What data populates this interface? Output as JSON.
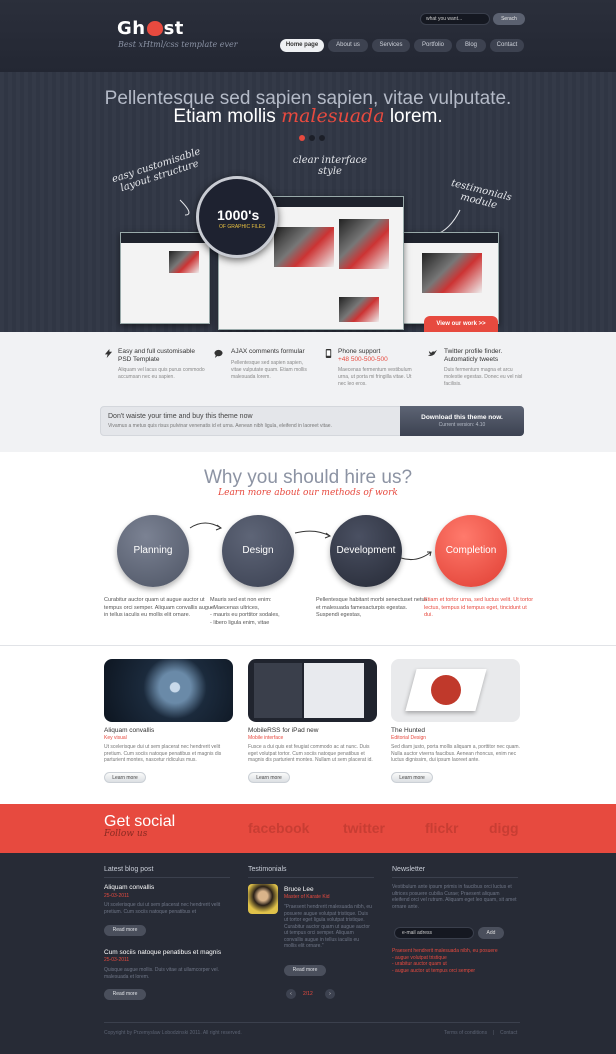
{
  "header": {
    "logo_pre": "Gh",
    "logo_post": "st",
    "tagline": "Best xHtml/css template ever",
    "search_placeholder": "what you want...",
    "search_button": "Serach",
    "nav": [
      "Home page",
      "About us",
      "Services",
      "Portfolio",
      "Blog",
      "Contact"
    ]
  },
  "hero": {
    "line1": "Pellentesque sed sapien sapien, vitae vulputate.",
    "line2_pre": "Etiam mollis",
    "line2_highlight": "malesuada",
    "line2_post": "lorem.",
    "note_left": "easy customisable layout structure",
    "note_center": "clear interface style",
    "note_right": "testimonials module",
    "magnifier_big": "1000's",
    "magnifier_small": "OF GRAPHIC FILES",
    "view_work": "View our work >>"
  },
  "features": [
    {
      "title": "Easy and full customisable PSD Template",
      "text": "Aliquam vel lacus quis purus commodo accumsan nec eu sapien."
    },
    {
      "title": "AJAX comments formular",
      "text": "Pellentesque sed sapien sapien, vitae vulputate quam. Etiam mollis malesuada lorem."
    },
    {
      "title": "Phone support",
      "phone": "+48 500-500-500",
      "text": "Maecenas fermentum vestibulum urna, ut porta mi fringilla vitae. Ut nec leo eros."
    },
    {
      "title": "Twitter profile finder. Automaticly tweets",
      "text": "Duis fermentum magna et arcu molestie egestas. Donec eu vel nisl facilisis."
    }
  ],
  "buybar": {
    "title": "Don't waiste your time and buy this theme now",
    "text": "Vivamus a metus quis risus pulvinar venenatis id et urna. Aenean nibh ligula, eleifend in laoreet vitae.",
    "button": "Download this theme now.",
    "version": "Current version: 4.10"
  },
  "why": {
    "title": "Why you should hire us?",
    "subtitle": "Learn more about our methods of work",
    "steps": [
      {
        "label": "Planning",
        "text": "Curabitur auctor quam ut augue auctor ut tempus orci semper. Aliquam convallis augue in tellus iaculis eu mollis elit ornare."
      },
      {
        "label": "Design",
        "text": "Mauris sed est non enim:",
        "list": [
          "- Maecenas ultrices,",
          "- mauris eu porttitor sodales,",
          "- libero ligula enim, vitae"
        ]
      },
      {
        "label": "Development",
        "text": "Pellentesque habitant morbi senectuset netus et malesuada famesacturpis egestas. Suspendi egestas,"
      },
      {
        "label": "Completion",
        "text": "Etiam et tortor urna, sed luctus velit. Ut tortor lectus, tempus id tempus eget, tincidunt ut dui."
      }
    ]
  },
  "portfolio": [
    {
      "title": "Aliquam convallis",
      "category": "Key visual",
      "text": "Ut scelerisque dui ut sem placerat nec hendrerit velit pretium. Cum sociis natoque penatibus et magnis dis parturient montes, nascetur ridiculus mus.",
      "button": "Learn more"
    },
    {
      "title": "MobileRSS for iPad new",
      "category": "Mobile interface",
      "text": "Fusce a dui quis est feugiat commodo ac at nunc. Duis eget volutpat tortor. Cum sociis natoque penatibus et magnis dis parturient montes. Nullam ut sem placerat id.",
      "button": "Learn more"
    },
    {
      "title": "The Hunted",
      "category": "Editorial Design",
      "text": "Sed diam justo, porta mollis aliquam a, porttitor nec quam. Nulla auctor viverra faucibus. Aenean rhoncus, enim nec luctus dignissim, dui ipsum laoreet ante.",
      "button": "Learn more"
    }
  ],
  "social": {
    "title": "Get social",
    "subtitle": "Follow us",
    "networks": [
      "facebook",
      "twitter",
      "flickr",
      "digg"
    ]
  },
  "footer": {
    "blog_heading": "Latest blog post",
    "posts": [
      {
        "title": "Aliquam convallis",
        "date": "25-03-2011",
        "text": "Ut scelerisque dui ut sem placerat nec hendrerit velit pretium. Cum sociis natoque penatibus et",
        "button": "Read more"
      },
      {
        "title": "Cum sociis natoque penatibus et magnis",
        "date": "25-03-2011",
        "text": "Quisque augue mollis. Duis vitae at ullamcorper vel. malesuada et lorem.",
        "button": "Read more"
      }
    ],
    "testimonials_heading": "Testimonials",
    "testimonial": {
      "name": "Bruce Lee",
      "role": "Master of Karate Kid",
      "text": "\"Praesent hendrerit malesuada nibh, eu posuere augue volutpat tristique. Duis ut tortor eget ligula volutpat tristique. Curabitur auctor quam ut augue auctor ut tempus orci semper. Aliquam convallis augue in tellus iaculis eu mollis elit ornare.\"",
      "button": "Read more"
    },
    "pager": {
      "prev": "‹",
      "text": "2/12",
      "next": "›"
    },
    "newsletter_heading": "Newsletter",
    "newsletter_text": "Vestibulum ante ipsum primis in faucibus orci luctus et ultrices posuere cubilia Curae; Praesent aliquam eleifend orci vel rutrum. Aliquam eget leo quam, sit amet ornare ante.",
    "email_placeholder": "e-mail adress",
    "add_button": "Add",
    "newsletter_red": "Praesent hendrerit malesuada nibh, eu posuere",
    "newsletter_list": [
      "- augue volutpat tristique",
      "- urabitur auctor quam ut",
      "- augue auctor ut tempus orci semper"
    ],
    "copyright": "Copyright by Przemyslaw Lobodzinski 2011. All right reserved.",
    "links": [
      "Terms of conditions",
      "|",
      "Contact"
    ]
  },
  "colors": {
    "accent": "#e74a3f",
    "dark": "#272b36",
    "hero": "#323846"
  }
}
